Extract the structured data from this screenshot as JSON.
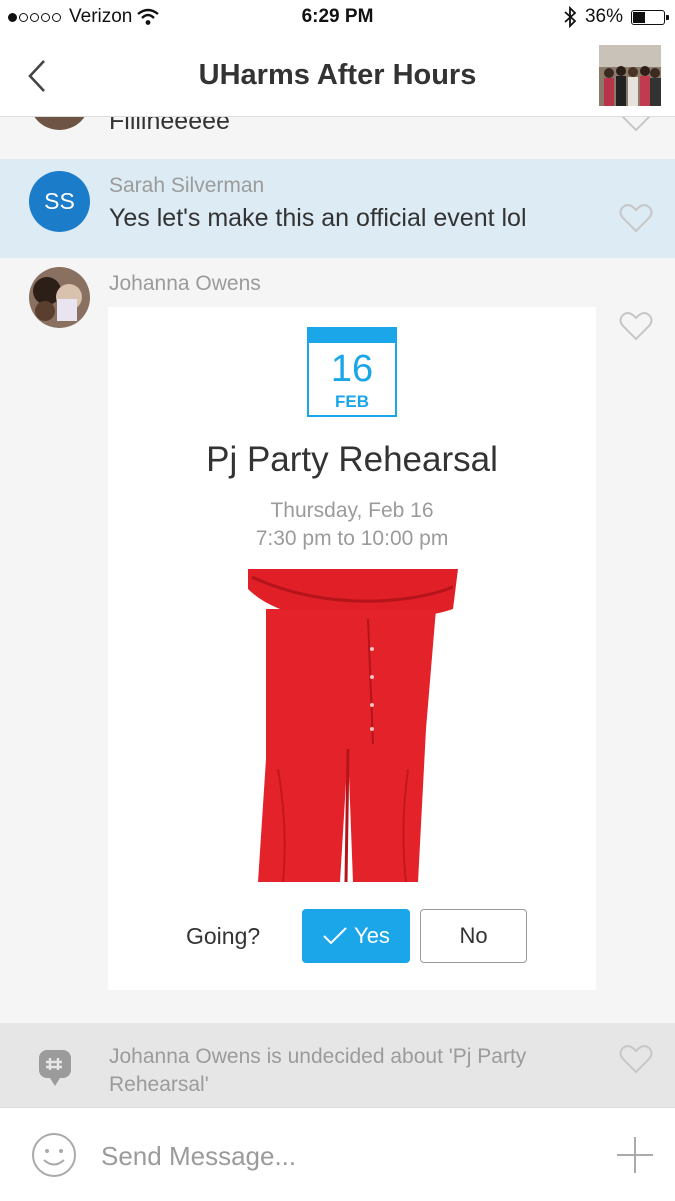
{
  "status_bar": {
    "carrier": "Verizon",
    "time": "6:29 PM",
    "battery": "36%",
    "battery_level": 0.36,
    "signal_bars": 1
  },
  "nav": {
    "title": "UHarms After Hours",
    "back_icon": "chevron-left-icon"
  },
  "messages": [
    {
      "text": "Fillineeeee"
    },
    {
      "initials": "SS",
      "sender": "Sarah Silverman",
      "text": "Yes let's make this an official event lol",
      "avatar_color": "#1b7cc9",
      "highlight_color": "#dcebf4"
    },
    {
      "sender": "Johanna Owens",
      "event": {
        "day": "16",
        "month": "FEB",
        "title": "Pj Party Rehearsal",
        "date_line": "Thursday, Feb 16",
        "time_line": "7:30 pm to 10:00 pm",
        "going_label": "Going?",
        "yes_label": "Yes",
        "no_label": "No",
        "accent_color": "#1aa6e8"
      }
    },
    {
      "system_text_line1": "Johanna Owens is undecided about 'Pj Party",
      "system_text_line2": "Rehearsal'"
    }
  ],
  "composer": {
    "placeholder": "Send Message..."
  }
}
